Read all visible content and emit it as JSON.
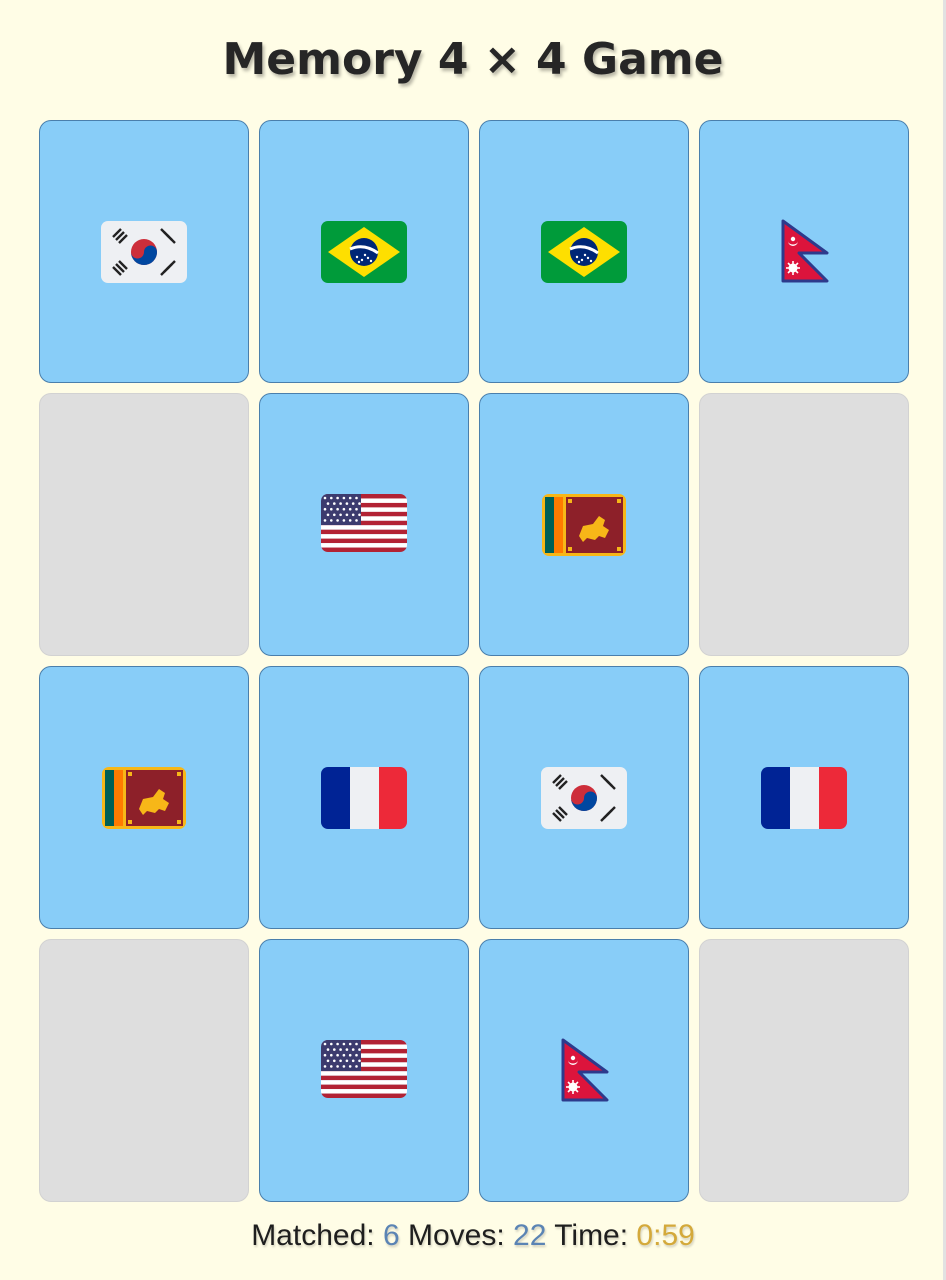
{
  "title": "Memory 4 × 4 Game",
  "status": {
    "matched_label": "Matched:",
    "matched_value": "6",
    "moves_label": "Moves:",
    "moves_value": "22",
    "time_label": "Time:",
    "time_value": "0:59"
  },
  "colors": {
    "background": "#fffde6",
    "card_revealed": "#88cdf8",
    "card_hidden": "#dedede",
    "number_accent": "#5b84b4",
    "time_accent": "#d4a93a"
  },
  "cards": [
    {
      "state": "revealed",
      "flag": "south-korea-flag-icon"
    },
    {
      "state": "revealed",
      "flag": "brazil-flag-icon"
    },
    {
      "state": "revealed",
      "flag": "brazil-flag-icon"
    },
    {
      "state": "revealed",
      "flag": "nepal-flag-icon"
    },
    {
      "state": "hidden",
      "flag": ""
    },
    {
      "state": "revealed",
      "flag": "usa-flag-icon"
    },
    {
      "state": "revealed",
      "flag": "sri-lanka-flag-icon"
    },
    {
      "state": "hidden",
      "flag": ""
    },
    {
      "state": "revealed",
      "flag": "sri-lanka-flag-icon"
    },
    {
      "state": "revealed",
      "flag": "france-flag-icon"
    },
    {
      "state": "revealed",
      "flag": "south-korea-flag-icon"
    },
    {
      "state": "revealed",
      "flag": "france-flag-icon"
    },
    {
      "state": "hidden",
      "flag": ""
    },
    {
      "state": "revealed",
      "flag": "usa-flag-icon"
    },
    {
      "state": "revealed",
      "flag": "nepal-flag-icon"
    },
    {
      "state": "hidden",
      "flag": ""
    }
  ]
}
